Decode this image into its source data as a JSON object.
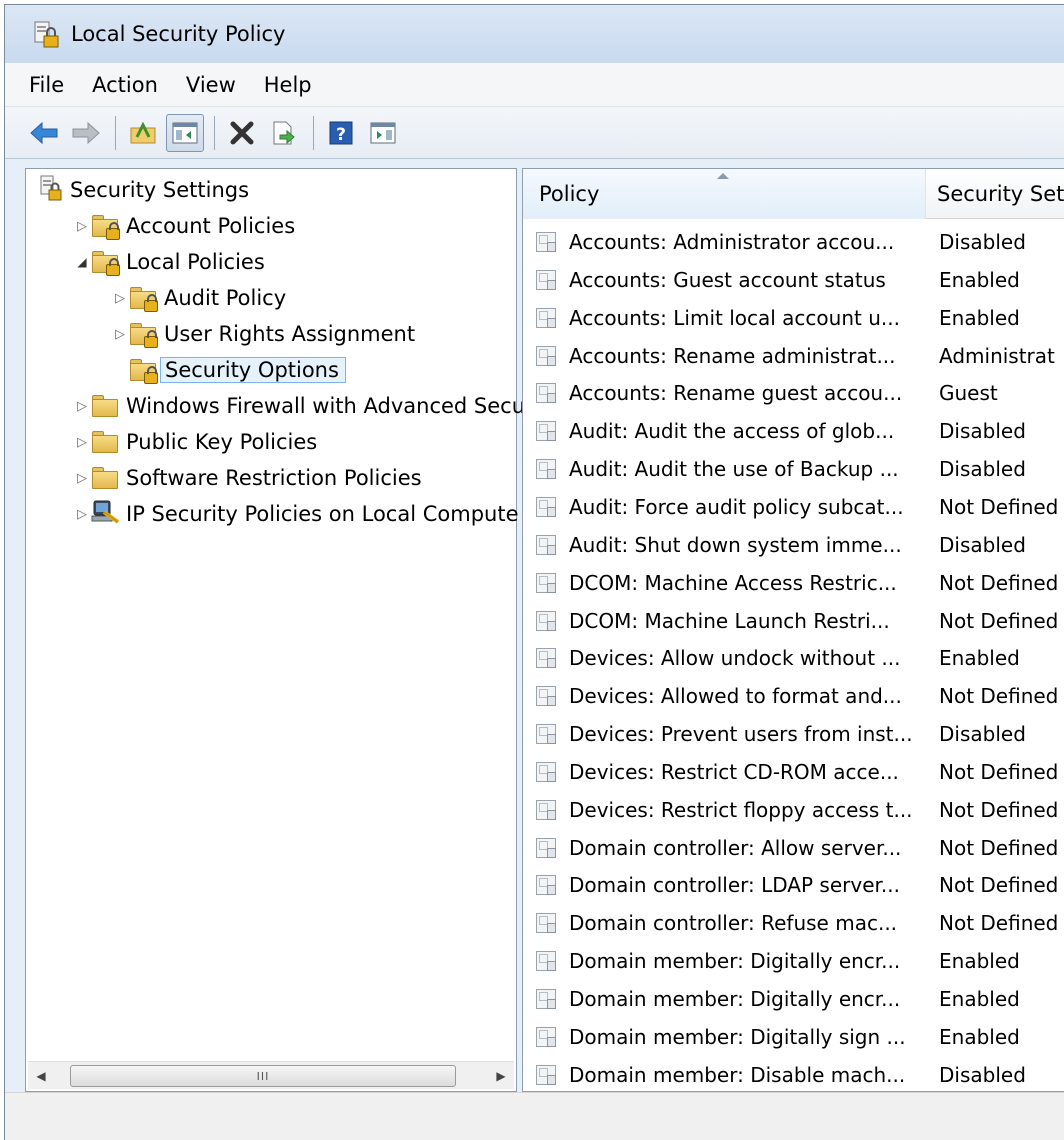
{
  "window": {
    "title": "Local Security Policy"
  },
  "menu": [
    "File",
    "Action",
    "View",
    "Help"
  ],
  "toolbar": {
    "icons": [
      "back-arrow-icon",
      "forward-arrow-icon",
      "up-folder-icon",
      "show-hide-tree-icon",
      "delete-icon",
      "export-list-icon",
      "help-icon",
      "show-hide-action-pane-icon"
    ],
    "help_glyph": "?"
  },
  "tree": {
    "items": [
      {
        "label": "Security Settings",
        "level": 0,
        "expander": "none",
        "icon": "security-settings-icon"
      },
      {
        "label": "Account Policies",
        "level": 1,
        "expander": "collapsed",
        "icon": "locked-folder-icon"
      },
      {
        "label": "Local Policies",
        "level": 1,
        "expander": "expanded",
        "icon": "locked-folder-icon"
      },
      {
        "label": "Audit Policy",
        "level": 2,
        "expander": "collapsed",
        "icon": "locked-folder-icon"
      },
      {
        "label": "User Rights Assignment",
        "level": 2,
        "expander": "collapsed",
        "icon": "locked-folder-icon"
      },
      {
        "label": "Security Options",
        "level": 2,
        "expander": "none",
        "icon": "locked-folder-icon",
        "selected": true
      },
      {
        "label": "Windows Firewall with Advanced Secu",
        "level": 1,
        "expander": "collapsed",
        "icon": "folder-icon"
      },
      {
        "label": "Public Key Policies",
        "level": 1,
        "expander": "collapsed",
        "icon": "folder-icon"
      },
      {
        "label": "Software Restriction Policies",
        "level": 1,
        "expander": "collapsed",
        "icon": "folder-icon"
      },
      {
        "label": "IP Security Policies on Local Compute",
        "level": 1,
        "expander": "collapsed",
        "icon": "ip-security-icon"
      }
    ],
    "scroll_grip": "III"
  },
  "list": {
    "columns": [
      "Policy",
      "Security Sett"
    ],
    "rows": [
      {
        "policy": "Accounts: Administrator accou...",
        "setting": "Disabled"
      },
      {
        "policy": "Accounts: Guest account status",
        "setting": "Enabled"
      },
      {
        "policy": "Accounts: Limit local account u...",
        "setting": "Enabled"
      },
      {
        "policy": "Accounts: Rename administrat...",
        "setting": "Administrat"
      },
      {
        "policy": "Accounts: Rename guest accou...",
        "setting": "Guest"
      },
      {
        "policy": "Audit: Audit the access of glob...",
        "setting": "Disabled"
      },
      {
        "policy": "Audit: Audit the use of Backup ...",
        "setting": "Disabled"
      },
      {
        "policy": "Audit: Force audit policy subcat...",
        "setting": "Not Defined"
      },
      {
        "policy": "Audit: Shut down system imme...",
        "setting": "Disabled"
      },
      {
        "policy": "DCOM: Machine Access Restric...",
        "setting": "Not Defined"
      },
      {
        "policy": "DCOM: Machine Launch Restri...",
        "setting": "Not Defined"
      },
      {
        "policy": "Devices: Allow undock without ...",
        "setting": "Enabled"
      },
      {
        "policy": "Devices: Allowed to format and...",
        "setting": "Not Defined"
      },
      {
        "policy": "Devices: Prevent users from inst...",
        "setting": "Disabled"
      },
      {
        "policy": "Devices: Restrict CD-ROM acce...",
        "setting": "Not Defined"
      },
      {
        "policy": "Devices: Restrict floppy access t...",
        "setting": "Not Defined"
      },
      {
        "policy": "Domain controller: Allow server...",
        "setting": "Not Defined"
      },
      {
        "policy": "Domain controller: LDAP server...",
        "setting": "Not Defined"
      },
      {
        "policy": "Domain controller: Refuse mac...",
        "setting": "Not Defined"
      },
      {
        "policy": "Domain member: Digitally encr...",
        "setting": "Enabled"
      },
      {
        "policy": "Domain member: Digitally encr...",
        "setting": "Enabled"
      },
      {
        "policy": "Domain member: Digitally sign ...",
        "setting": "Enabled"
      },
      {
        "policy": "Domain member: Disable mach...",
        "setting": "Disabled"
      }
    ]
  },
  "colors": {
    "selection_border": "#7eb4ea",
    "selection_fill": "#e5f1fb",
    "back_arrow": "#3a86d6",
    "folder": "#f0cc6a"
  }
}
